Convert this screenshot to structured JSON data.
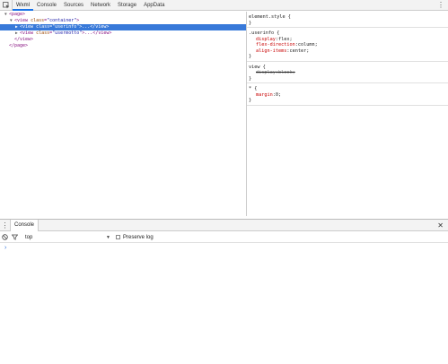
{
  "toolbar": {
    "inspect_icon": "inspect-element-icon",
    "tabs": [
      {
        "label": "Wxml",
        "active": true
      },
      {
        "label": "Console",
        "active": false
      },
      {
        "label": "Sources",
        "active": false
      },
      {
        "label": "Network",
        "active": false
      },
      {
        "label": "Storage",
        "active": false
      },
      {
        "label": "AppData",
        "active": false
      }
    ],
    "more_icon": "vertical-dots-icon",
    "more_glyph": "⋮"
  },
  "elements": {
    "lines": [
      {
        "arrow": "▼",
        "open": "<page>",
        "indent": 0
      },
      {
        "arrow": "▼",
        "tag_open": "<view ",
        "attr": "class",
        "eq": "=",
        "val": "\"container\"",
        "tag_close": ">",
        "indent": 1
      },
      {
        "arrow": "▶",
        "tag_open": "<view ",
        "attr": "class",
        "eq": "=",
        "val": "\"userinfo\"",
        "tag_close": ">...</view>",
        "indent": 2,
        "selected": true
      },
      {
        "arrow": "▶",
        "tag_open": "<view ",
        "attr": "class",
        "eq": "=",
        "val": "\"usermotto\"",
        "tag_close": ">...</view>",
        "indent": 2
      },
      {
        "arrow": "",
        "open": "</view>",
        "indent": 1
      },
      {
        "arrow": "",
        "open": "</page>",
        "indent": 0
      }
    ]
  },
  "styles": {
    "rules": [
      {
        "selector": "element.style {",
        "props": [],
        "close": "}"
      },
      {
        "selector": ".userinfo {",
        "props": [
          {
            "name": "display",
            "value": "flex;"
          },
          {
            "name": "flex-direction",
            "value": "column;"
          },
          {
            "name": "align-items",
            "value": "center;"
          }
        ],
        "close": "}"
      },
      {
        "selector": "view {",
        "props": [
          {
            "name": "display",
            "value": "block;",
            "struck": true
          }
        ],
        "close": "}"
      },
      {
        "selector": "* {",
        "props": [
          {
            "name": "margin",
            "value": "0;"
          }
        ],
        "close": "}"
      }
    ]
  },
  "drawer": {
    "menu_glyph": "⋮",
    "tab_label": "Console",
    "close_glyph": "✕",
    "context_value": "top",
    "context_arrow": "▼",
    "preserve_log_label": "Preserve log",
    "preserve_log_checked": false,
    "prompt_glyph": "›"
  }
}
